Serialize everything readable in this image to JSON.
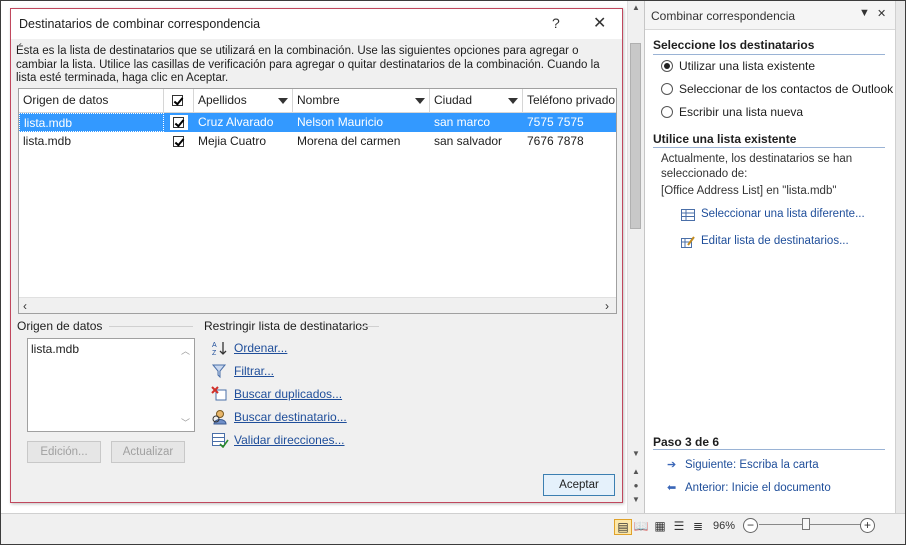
{
  "dialog": {
    "title": "Destinatarios de combinar correspondencia",
    "help": "?",
    "close": "✕",
    "intro": "Ésta es la lista de destinatarios que se utilizará en la combinación. Use las siguientes opciones para agregar o cambiar la lista. Utilice las casillas de verificación para agregar o quitar destinatarios de la combinación. Cuando la lista esté terminada, haga clic en Aceptar.",
    "columns": [
      "Origen de datos",
      "",
      "Apellidos",
      "Nombre",
      "Ciudad",
      "Teléfono privado"
    ],
    "rows": [
      {
        "origen": "lista.mdb",
        "checked": true,
        "apellidos": "Cruz Alvarado",
        "nombre": "Nelson Mauricio",
        "ciudad": "san marco",
        "telefono": "7575 7575",
        "selected": true
      },
      {
        "origen": "lista.mdb",
        "checked": true,
        "apellidos": "Mejia Cuatro",
        "nombre": "Morena del carmen",
        "ciudad": "san salvador",
        "telefono": "7676 7878",
        "selected": false
      }
    ],
    "source_group_label": "Origen de datos",
    "source_items": [
      "lista.mdb"
    ],
    "edit_button": "Edición...",
    "refresh_button": "Actualizar",
    "refine_group_label": "Restringir lista de destinatarios",
    "actions": {
      "sort": "Ordenar...",
      "filter": "Filtrar...",
      "duplicates": "Buscar duplicados...",
      "find": "Buscar destinatario...",
      "validate": "Validar direcciones..."
    },
    "ok_button": "Aceptar"
  },
  "taskpane": {
    "title": "Combinar correspondencia",
    "section1": "Seleccione los destinatarios",
    "options": [
      {
        "label": "Utilizar una lista existente",
        "selected": true
      },
      {
        "label": "Seleccionar de los contactos de Outlook",
        "selected": false
      },
      {
        "label": "Escribir una lista nueva",
        "selected": false
      }
    ],
    "section2": "Utilice una lista existente",
    "current_text": "Actualmente, los destinatarios se han seleccionado de:",
    "current_source": "[Office Address List] en \"lista.mdb\"",
    "link_select": "Seleccionar una lista diferente...",
    "link_edit": "Editar lista de destinatarios...",
    "step": "Paso 3 de 6",
    "next": "Siguiente: Escriba la carta",
    "prev": "Anterior: Inicie el documento"
  },
  "statusbar": {
    "zoom": "96%"
  }
}
